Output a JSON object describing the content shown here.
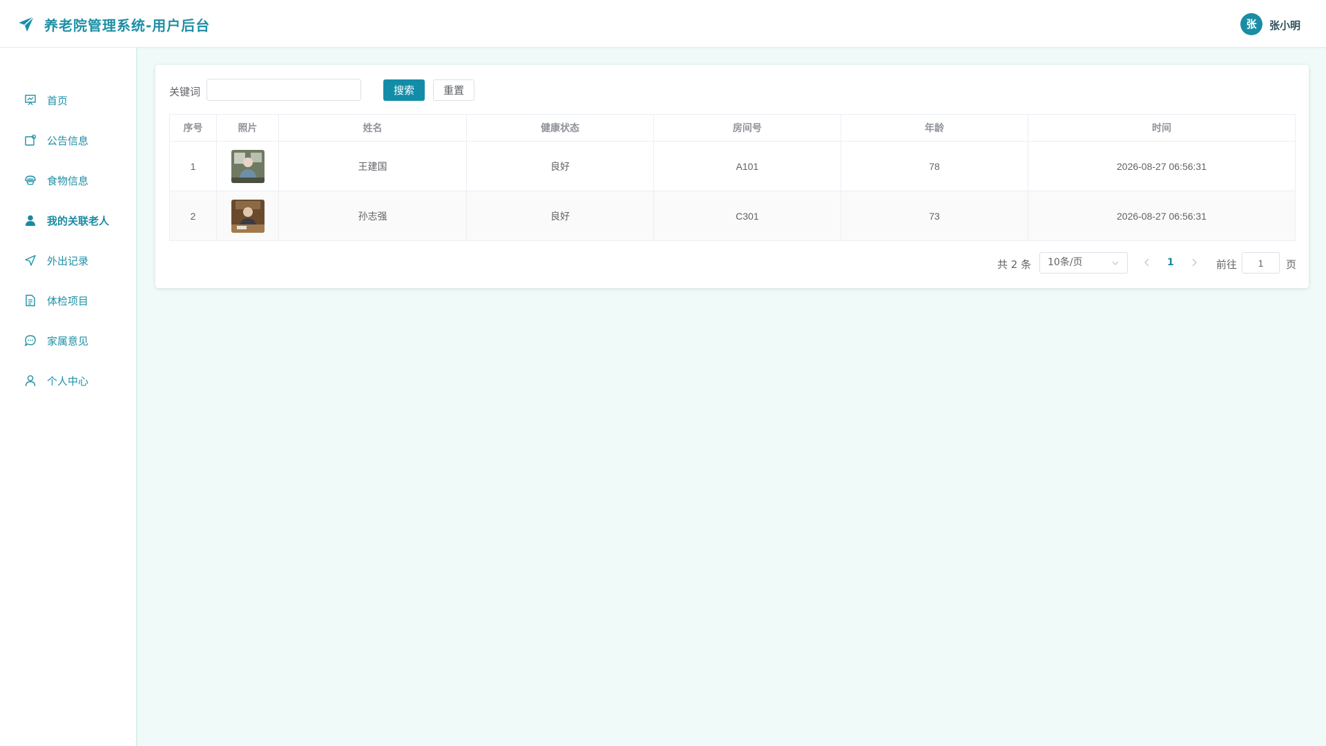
{
  "header": {
    "title": "养老院管理系统-用户后台",
    "avatar_initial": "张",
    "username": "张小明"
  },
  "sidebar": {
    "items": [
      {
        "label": "首页",
        "icon": "monitor-icon"
      },
      {
        "label": "公告信息",
        "icon": "notice-icon"
      },
      {
        "label": "食物信息",
        "icon": "food-icon"
      },
      {
        "label": "我的关联老人",
        "icon": "user-filled-icon",
        "active": true
      },
      {
        "label": "外出记录",
        "icon": "send-icon"
      },
      {
        "label": "体检项目",
        "icon": "document-icon"
      },
      {
        "label": "家属意见",
        "icon": "chat-icon"
      },
      {
        "label": "个人中心",
        "icon": "user-icon"
      }
    ]
  },
  "search": {
    "label": "关键词",
    "value": "",
    "search_button": "搜索",
    "reset_button": "重置"
  },
  "table": {
    "columns": [
      "序号",
      "照片",
      "姓名",
      "健康状态",
      "房间号",
      "年龄",
      "时间"
    ],
    "rows": [
      {
        "index": "1",
        "photo": "elderly-man-photo",
        "name": "王建国",
        "health": "良好",
        "room": "A101",
        "age": "78",
        "time": "2026-08-27 06:56:31"
      },
      {
        "index": "2",
        "photo": "elderly-man-photo",
        "name": "孙志强",
        "health": "良好",
        "room": "C301",
        "age": "73",
        "time": "2026-08-27 06:56:31"
      }
    ]
  },
  "pagination": {
    "total": "共 2 条",
    "page_size": "10条/页",
    "current_page": "1",
    "goto_label": "前往",
    "goto_value": "1",
    "page_suffix": "页"
  },
  "colors": {
    "accent": "#1a8da5",
    "background": "#f0fbf9"
  }
}
